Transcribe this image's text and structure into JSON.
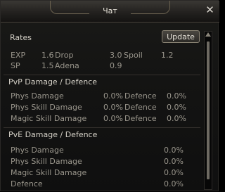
{
  "window": {
    "title": "Чат",
    "close_glyph": "✕"
  },
  "rates": {
    "heading": "Rates",
    "update_label": "Update",
    "row1": {
      "exp_label": "EXP",
      "exp_value": "1.6",
      "drop_label": "Drop",
      "drop_value": "3.0",
      "spoil_label": "Spoil",
      "spoil_value": "1.2"
    },
    "row2": {
      "sp_label": "SP",
      "sp_value": "1.5",
      "adena_label": "Adena",
      "adena_value": "0.9"
    }
  },
  "pvp": {
    "heading": "PvP Damage / Defence",
    "rows": [
      {
        "label": "Phys Damage",
        "damage": "0.0%",
        "def_label": "Defence",
        "def_value": "0.0%"
      },
      {
        "label": "Phys Skill Damage",
        "damage": "0.0%",
        "def_label": "Defence",
        "def_value": "0.0%"
      },
      {
        "label": "Magic Skill Damage",
        "damage": "0.0%",
        "def_label": "Defence",
        "def_value": "0.0%"
      }
    ]
  },
  "pve": {
    "heading": "PvE Damage / Defence",
    "rows": [
      {
        "label": "Phys Damage",
        "value": "0.0%"
      },
      {
        "label": "Phys Skill Damage",
        "value": "0.0%"
      },
      {
        "label": "Magic Skill Damage",
        "value": "0.0%"
      },
      {
        "label": "Defence",
        "value": "0.0%"
      }
    ]
  },
  "icons": {
    "close": "close-icon",
    "scroll_up": "scroll-up-arrow-icon"
  },
  "colors": {
    "window_bg": "#141413",
    "heading_text": "#d6d2c8",
    "body_text": "#9a968c",
    "title_text": "#e8e4da"
  }
}
